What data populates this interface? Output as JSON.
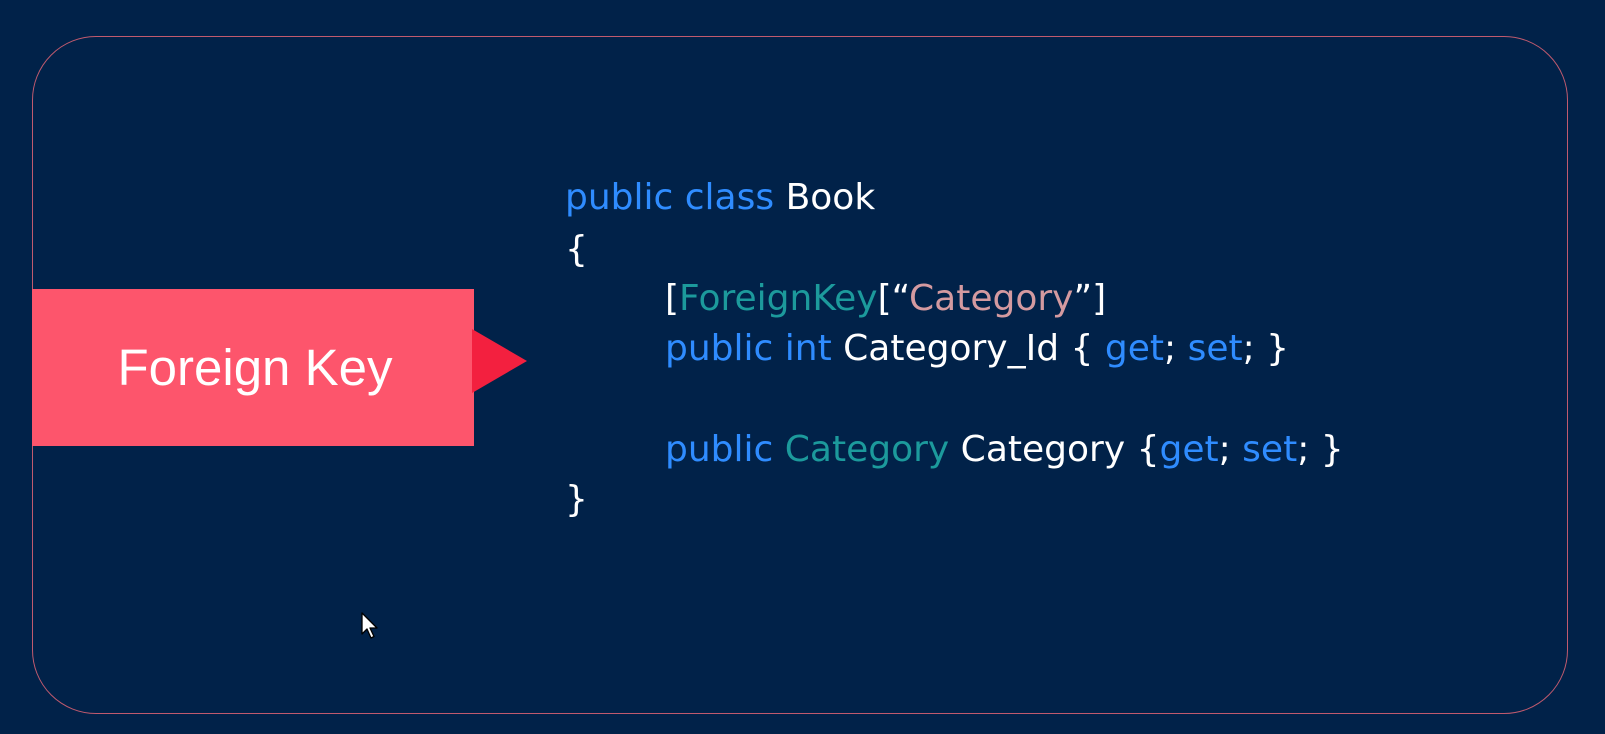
{
  "callout": {
    "label": "Foreign Key"
  },
  "code": {
    "line1": {
      "kw": "public class",
      "name": " Book"
    },
    "line2": {
      "text": "{"
    },
    "line3": {
      "open": "[",
      "type": "ForeignKey",
      "mid": "[“",
      "str": "Category",
      "close": "”]"
    },
    "line4": {
      "kw": "public int",
      "name": " Category_Id { ",
      "get": "get",
      "sep": "; ",
      "set": "set",
      "end": "; }"
    },
    "line6": {
      "kw": "public",
      "sp": " ",
      "type": "Category",
      "name": " Category {",
      "get": "get",
      "sep": "; ",
      "set": "set",
      "end": "; }"
    },
    "line7": {
      "text": "}"
    }
  },
  "colors": {
    "background": "#012249",
    "frame_border": "#c05a6e",
    "callout": "#fd556c",
    "pointer": "#f3203f",
    "keyword": "#2f8cff",
    "type": "#1c9a9c",
    "string": "#d49aa0"
  },
  "icons": {
    "cursor": "mouse-pointer-icon"
  }
}
